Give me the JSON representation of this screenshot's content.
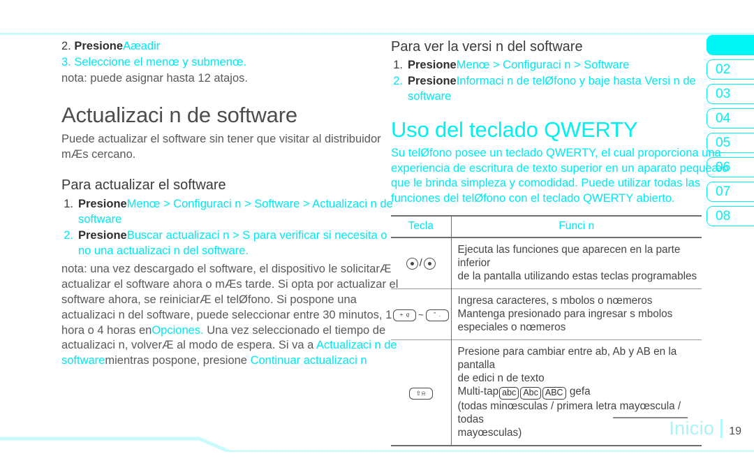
{
  "page": {
    "number": "19",
    "footer_label": "Inicio",
    "accent_color": "#00f0f0",
    "heading_color": "#4d4d4d",
    "body_color": "#595959",
    "rule_color": "#c9fbfb"
  },
  "sidebar": {
    "tabs": [
      {
        "label": "",
        "active": true
      },
      {
        "label": "02",
        "active": false
      },
      {
        "label": "03",
        "active": false
      },
      {
        "label": "04",
        "active": false
      },
      {
        "label": "05",
        "active": false
      },
      {
        "label": "06",
        "active": false
      },
      {
        "label": "07",
        "active": false
      },
      {
        "label": "08",
        "active": false
      }
    ]
  },
  "left_column": {
    "carryover_steps": [
      {
        "num": "2.",
        "lead": "Presione",
        "link": "Aæadir"
      },
      {
        "num": "3.",
        "text": "Seleccione el menœ y submenœ."
      }
    ],
    "carryover_note": "nota:  puede asignar hasta 12 atajos.",
    "section_title": "Actualizaci n de software",
    "section_intro": "Puede actualizar el software sin tener que visitar al distribuidor mÆs cercano.",
    "subsection_title": "Para actualizar el software",
    "steps": [
      {
        "num": "1.",
        "lead": "Presione",
        "link": "Menœ > Configuraci n > Software > Actualizaci n de software"
      },
      {
        "num": "2.",
        "lead": "Presione",
        "link": "Buscar actualizaci n > S para verificar si necesita o no una actualizaci n del software."
      }
    ],
    "note_label": "nota:",
    "note_body_1": "una vez descargado el software, el dispositivo le solicitarÆ actualizar el software ahora o mÆs tarde. Si opta por actualizar el software ahora, se reiniciarÆ el telØfono. Si pospone una actualizaci n del software, puede seleccionar entre 30 minutos, 1 hora o 4 horas en",
    "note_link_1": "Opciones.",
    "note_body_2": " Una vez seleccionado el tiempo de actualizaci n, volverÆ al modo de espera. Si va a",
    "note_link_2": "Actualizaci n de software",
    "note_body_3": "mientras pospone, presione",
    "note_link_3": "Continuar actualizaci n"
  },
  "right_column": {
    "version_title": "Para ver la versi n del software",
    "version_steps": [
      {
        "num": "1.",
        "lead": "Presione",
        "link": "Menœ > Configuraci n > Software"
      },
      {
        "num": "2.",
        "lead": "Presione",
        "link": "Informaci n de telØfono y baje hasta Versi n de software"
      }
    ],
    "qwerty_title": "Uso del teclado QWERTY",
    "qwerty_body": "Su telØfono posee un teclado QWERTY, el cual proporciona una experiencia de escritura de texto superior en un aparato pequeæo que le brinda simpleza y comodidad. Puede utilizar todas las funciones del telØfono con el teclado QWERTY abierto.",
    "table": {
      "headers": [
        "Tecla",
        "Funci n"
      ],
      "rows": [
        {
          "key_icon": "soft-keys-icon",
          "key_caption": "",
          "lines": [
            "Ejecuta las funciones que aparecen en la parte inferior",
            "de la pantalla utilizando estas teclas programables"
          ]
        },
        {
          "key_icon": "character-keys-icon",
          "key_caption": "",
          "lines": [
            "Ingresa caracteres, s mbolos o nœmeros",
            "Mantenga presionado para ingresar s mbolos",
            "especiales o nœmeros"
          ]
        },
        {
          "key_icon": "shift-key-icon",
          "key_caption": "",
          "lines": [
            "Presione para cambiar entre ab, Ab y AB en la pantalla",
            "de edici n de texto",
            "multitap_line",
            "(todas minœsculas / primera letra mayœscula / todas",
            "mayœsculas)"
          ],
          "multitap": {
            "prefix": "Multi-tap",
            "badges": [
              "abc",
              "Abc",
              "ABC"
            ],
            "suffix": "gefa"
          }
        }
      ]
    }
  }
}
